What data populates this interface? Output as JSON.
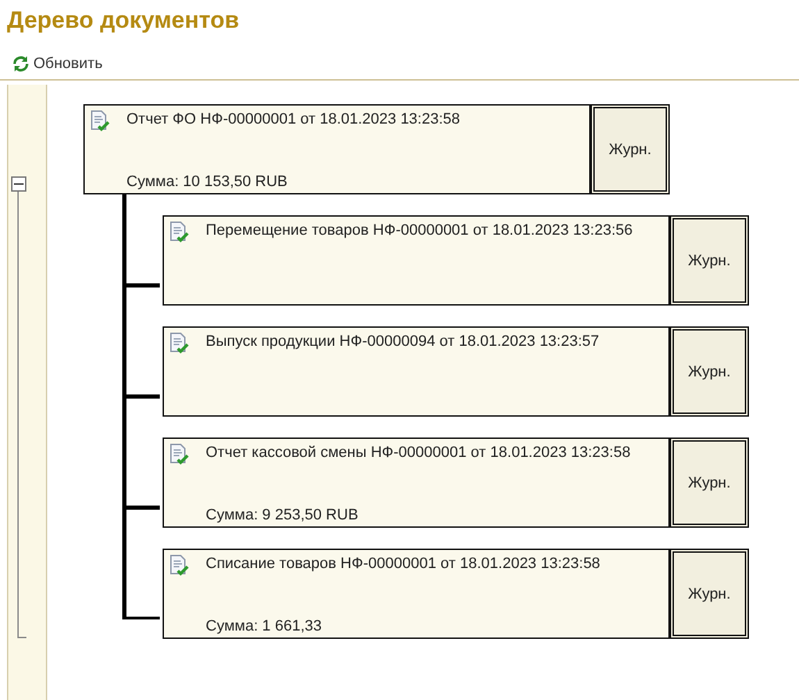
{
  "title": "Дерево документов",
  "toolbar": {
    "refresh_label": "Обновить"
  },
  "tree": {
    "expanded": true,
    "root": {
      "title": "Отчет ФО НФ-00000001 от 18.01.2023 13:23:58",
      "sum": "Сумма: 10 153,50 RUB",
      "button": "Журн."
    },
    "children": [
      {
        "title": "Перемещение товаров НФ-00000001 от 18.01.2023 13:23:56",
        "button": "Журн."
      },
      {
        "title": "Выпуск продукции НФ-00000094 от 18.01.2023 13:23:57",
        "button": "Журн."
      },
      {
        "title": "Отчет кассовой смены НФ-00000001 от 18.01.2023 13:23:58",
        "sum": "Сумма: 9 253,50 RUB",
        "button": "Журн."
      },
      {
        "title": "Списание товаров НФ-00000001 от 18.01.2023 13:23:58",
        "sum": "Сумма: 1 661,33",
        "button": "Журн."
      }
    ]
  }
}
